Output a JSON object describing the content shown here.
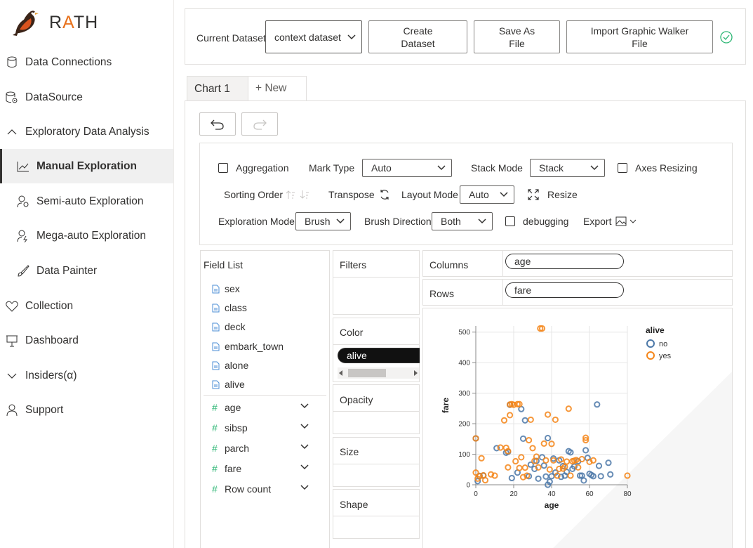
{
  "app": {
    "logo_text_r": "R",
    "logo_text_a": "A",
    "logo_text_th": "TH"
  },
  "sidebar": {
    "items": [
      {
        "label": "Data Connections",
        "icon": "database-icon"
      },
      {
        "label": "DataSource",
        "icon": "database-settings-icon"
      },
      {
        "label": "Exploratory Data Analysis",
        "icon": "chevron-up-icon"
      },
      {
        "label": "Manual Exploration",
        "icon": "line-chart-icon",
        "active": true
      },
      {
        "label": "Semi-auto Exploration",
        "icon": "person-gear-icon"
      },
      {
        "label": "Mega-auto Exploration",
        "icon": "person-bolt-icon"
      },
      {
        "label": "Data Painter",
        "icon": "brush-icon"
      },
      {
        "label": "Collection",
        "icon": "heart-icon"
      },
      {
        "label": "Dashboard",
        "icon": "presentation-icon"
      },
      {
        "label": "Insiders(α)",
        "icon": "chevron-down-icon"
      },
      {
        "label": "Support",
        "icon": "person-icon"
      }
    ]
  },
  "toolbar": {
    "current_dataset_label": "Current Dataset",
    "dataset_value": "context dataset",
    "create_dataset_label": "Create Dataset",
    "save_as_file_label": "Save As File",
    "import_label": "Import Graphic Walker File",
    "status_icon": "check-circle-icon"
  },
  "tabs": [
    {
      "label": "Chart 1",
      "active": true
    },
    {
      "label": "+ New",
      "active": false
    }
  ],
  "settings": {
    "aggregation_label": "Aggregation",
    "aggregation_checked": false,
    "mark_type_label": "Mark Type",
    "mark_type_value": "Auto",
    "stack_mode_label": "Stack Mode",
    "stack_mode_value": "Stack",
    "axes_resizing_label": "Axes Resizing",
    "axes_resizing_checked": false,
    "sorting_order_label": "Sorting Order",
    "transpose_label": "Transpose",
    "layout_mode_label": "Layout Mode",
    "layout_mode_value": "Auto",
    "resize_label": "Resize",
    "exploration_mode_label": "Exploration Mode",
    "exploration_mode_value": "Brush",
    "brush_direction_label": "Brush Direction",
    "brush_direction_value": "Both",
    "debugging_label": "debugging",
    "debugging_checked": false,
    "export_label": "Export"
  },
  "field_list": {
    "title": "Field List",
    "dimensions": [
      "sex",
      "class",
      "deck",
      "embark_town",
      "alone",
      "alive"
    ],
    "measures": [
      "age",
      "sibsp",
      "parch",
      "fare",
      "Row count"
    ]
  },
  "encodings": {
    "filters_label": "Filters",
    "color_label": "Color",
    "color_field": "alive",
    "opacity_label": "Opacity",
    "size_label": "Size",
    "shape_label": "Shape",
    "columns_label": "Columns",
    "columns_field": "age",
    "rows_label": "Rows",
    "rows_field": "fare"
  },
  "colors": {
    "no": "#4c78a8",
    "yes": "#f58518",
    "accent_green": "#2bb673"
  },
  "chart_data": {
    "type": "scatter",
    "xlabel": "age",
    "ylabel": "fare",
    "xlim": [
      0,
      80
    ],
    "ylim": [
      0,
      520
    ],
    "x_ticks": [
      0,
      20,
      40,
      60,
      80
    ],
    "y_ticks": [
      0,
      100,
      200,
      300,
      400,
      500
    ],
    "grid": true,
    "legend": {
      "title": "alive",
      "placement": "top-right",
      "entries": [
        "no",
        "yes"
      ]
    },
    "series": [
      {
        "name": "no",
        "points": [
          [
            0,
            152
          ],
          [
            1,
            12
          ],
          [
            2,
            29
          ],
          [
            4,
            30
          ],
          [
            11,
            120
          ],
          [
            16,
            105
          ],
          [
            17,
            108
          ],
          [
            18,
            262
          ],
          [
            19,
            22
          ],
          [
            22,
            40
          ],
          [
            24,
            248
          ],
          [
            25,
            151
          ],
          [
            26,
            211
          ],
          [
            28,
            28
          ],
          [
            29,
            66
          ],
          [
            31,
            52
          ],
          [
            32,
            78
          ],
          [
            33,
            20
          ],
          [
            35,
            90
          ],
          [
            36,
            63
          ],
          [
            37,
            27
          ],
          [
            38,
            153
          ],
          [
            38,
            0
          ],
          [
            39,
            10
          ],
          [
            40,
            28
          ],
          [
            41,
            86
          ],
          [
            42,
            40
          ],
          [
            44,
            80
          ],
          [
            45,
            26
          ],
          [
            46,
            61
          ],
          [
            47,
            30
          ],
          [
            48,
            42
          ],
          [
            49,
            110
          ],
          [
            50,
            106
          ],
          [
            51,
            52
          ],
          [
            52,
            60
          ],
          [
            54,
            77
          ],
          [
            55,
            30
          ],
          [
            56,
            30
          ],
          [
            57,
            14
          ],
          [
            58,
            113
          ],
          [
            59,
            88
          ],
          [
            60,
            36
          ],
          [
            61,
            32
          ],
          [
            62,
            28
          ],
          [
            64,
            263
          ],
          [
            65,
            62
          ],
          [
            66,
            28
          ],
          [
            70,
            72
          ],
          [
            71,
            34
          ]
        ]
      },
      {
        "name": "yes",
        "points": [
          [
            0,
            152
          ],
          [
            0,
            40
          ],
          [
            1,
            20
          ],
          [
            2,
            28
          ],
          [
            3,
            87
          ],
          [
            4,
            31
          ],
          [
            5,
            15
          ],
          [
            8,
            34
          ],
          [
            10,
            30
          ],
          [
            13,
            122
          ],
          [
            15,
            211
          ],
          [
            16,
            121
          ],
          [
            17,
            57
          ],
          [
            17,
            110
          ],
          [
            18,
            263
          ],
          [
            18,
            228
          ],
          [
            19,
            264
          ],
          [
            20,
            262
          ],
          [
            21,
            77
          ],
          [
            22,
            264
          ],
          [
            23,
            264
          ],
          [
            23,
            55
          ],
          [
            24,
            90
          ],
          [
            25,
            25
          ],
          [
            26,
            56
          ],
          [
            27,
            30
          ],
          [
            28,
            146
          ],
          [
            29,
            213
          ],
          [
            30,
            120
          ],
          [
            31,
            78
          ],
          [
            32,
            92
          ],
          [
            33,
            57
          ],
          [
            34,
            512
          ],
          [
            35,
            512
          ],
          [
            36,
            135
          ],
          [
            37,
            80
          ],
          [
            38,
            230
          ],
          [
            39,
            50
          ],
          [
            40,
            134
          ],
          [
            41,
            80
          ],
          [
            42,
            213
          ],
          [
            43,
            30
          ],
          [
            44,
            52
          ],
          [
            45,
            83
          ],
          [
            46,
            53
          ],
          [
            47,
            59
          ],
          [
            48,
            76
          ],
          [
            49,
            249
          ],
          [
            50,
            30
          ],
          [
            51,
            77
          ],
          [
            52,
            79
          ],
          [
            53,
            81
          ],
          [
            54,
            57
          ],
          [
            56,
            84
          ],
          [
            58,
            146
          ],
          [
            58,
            154
          ],
          [
            60,
            75
          ],
          [
            62,
            80
          ],
          [
            80,
            30
          ]
        ]
      }
    ]
  }
}
